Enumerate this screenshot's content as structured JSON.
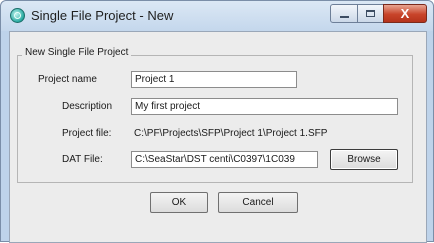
{
  "window": {
    "title": "Single File Project - New",
    "icon": "globe-app-icon"
  },
  "controls": {
    "minimize": "minimize-icon",
    "maximize": "maximize-icon",
    "close_label": "X"
  },
  "group": {
    "title": "New Single File Project"
  },
  "fields": {
    "project_name": {
      "label": "Project name",
      "value": "Project 1"
    },
    "description": {
      "label": "Description",
      "value": "My first project"
    },
    "project_file": {
      "label": "Project file:",
      "value": "C:\\PF\\Projects\\SFP\\Project 1\\Project 1.SFP"
    },
    "dat_file": {
      "label": "DAT File:",
      "value": "C:\\SeaStar\\DST centi\\C0397\\1C039"
    }
  },
  "buttons": {
    "browse": "Browse",
    "ok": "OK",
    "cancel": "Cancel"
  }
}
